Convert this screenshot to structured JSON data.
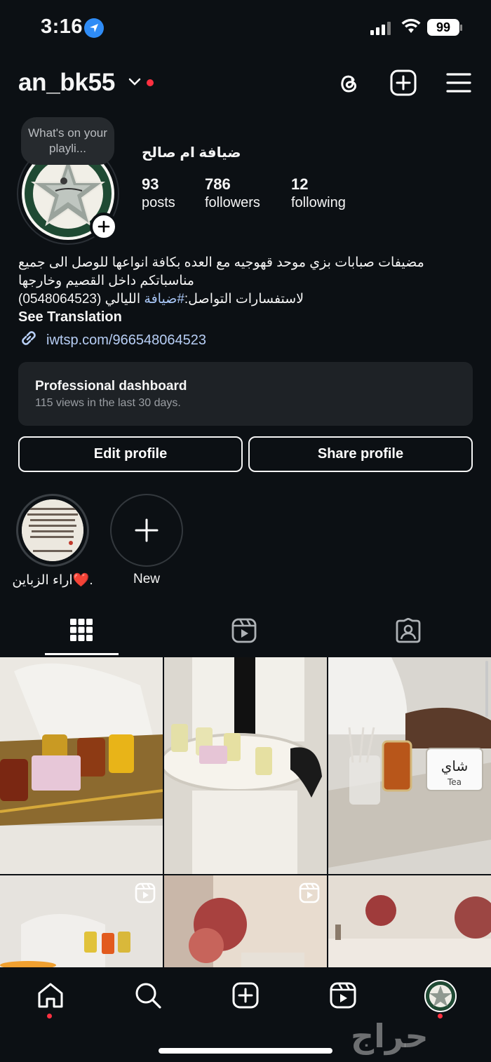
{
  "status": {
    "time": "3:16",
    "battery": "99"
  },
  "header": {
    "username": "an_bk55"
  },
  "note": {
    "text": "What's on your playli..."
  },
  "profile": {
    "display_name": "ضيافة ام صالح",
    "stats": [
      {
        "value": "93",
        "label": "posts"
      },
      {
        "value": "786",
        "label": "followers"
      },
      {
        "value": "12",
        "label": "following"
      }
    ]
  },
  "bio": {
    "line1": "مضيفات صبابات بزي موحد قهوجيه مع العده بكافة انواعها للوصل الى جميع",
    "line2": "مناسباتكم داخل القصيم وخارجها",
    "line3_prefix": "لاستفسارات التواصل:",
    "line3_hashtag": "#ضيافة",
    "line3_suffix": " الليالي (0548064523)",
    "see_translation": "See Translation",
    "link": "iwtsp.com/966548064523"
  },
  "dashboard": {
    "title": "Professional dashboard",
    "subtitle": "115 views in the last 30 days."
  },
  "buttons": {
    "edit": "Edit profile",
    "share": "Share profile"
  },
  "highlights": [
    {
      "label": "اراء الزباين❤️."
    },
    {
      "label": "New"
    }
  ],
  "watermark": "حراج",
  "colors": {
    "background": "#0c1014",
    "notification": "#ff3040",
    "link": "#b7cef5",
    "card": "#1e2226"
  }
}
